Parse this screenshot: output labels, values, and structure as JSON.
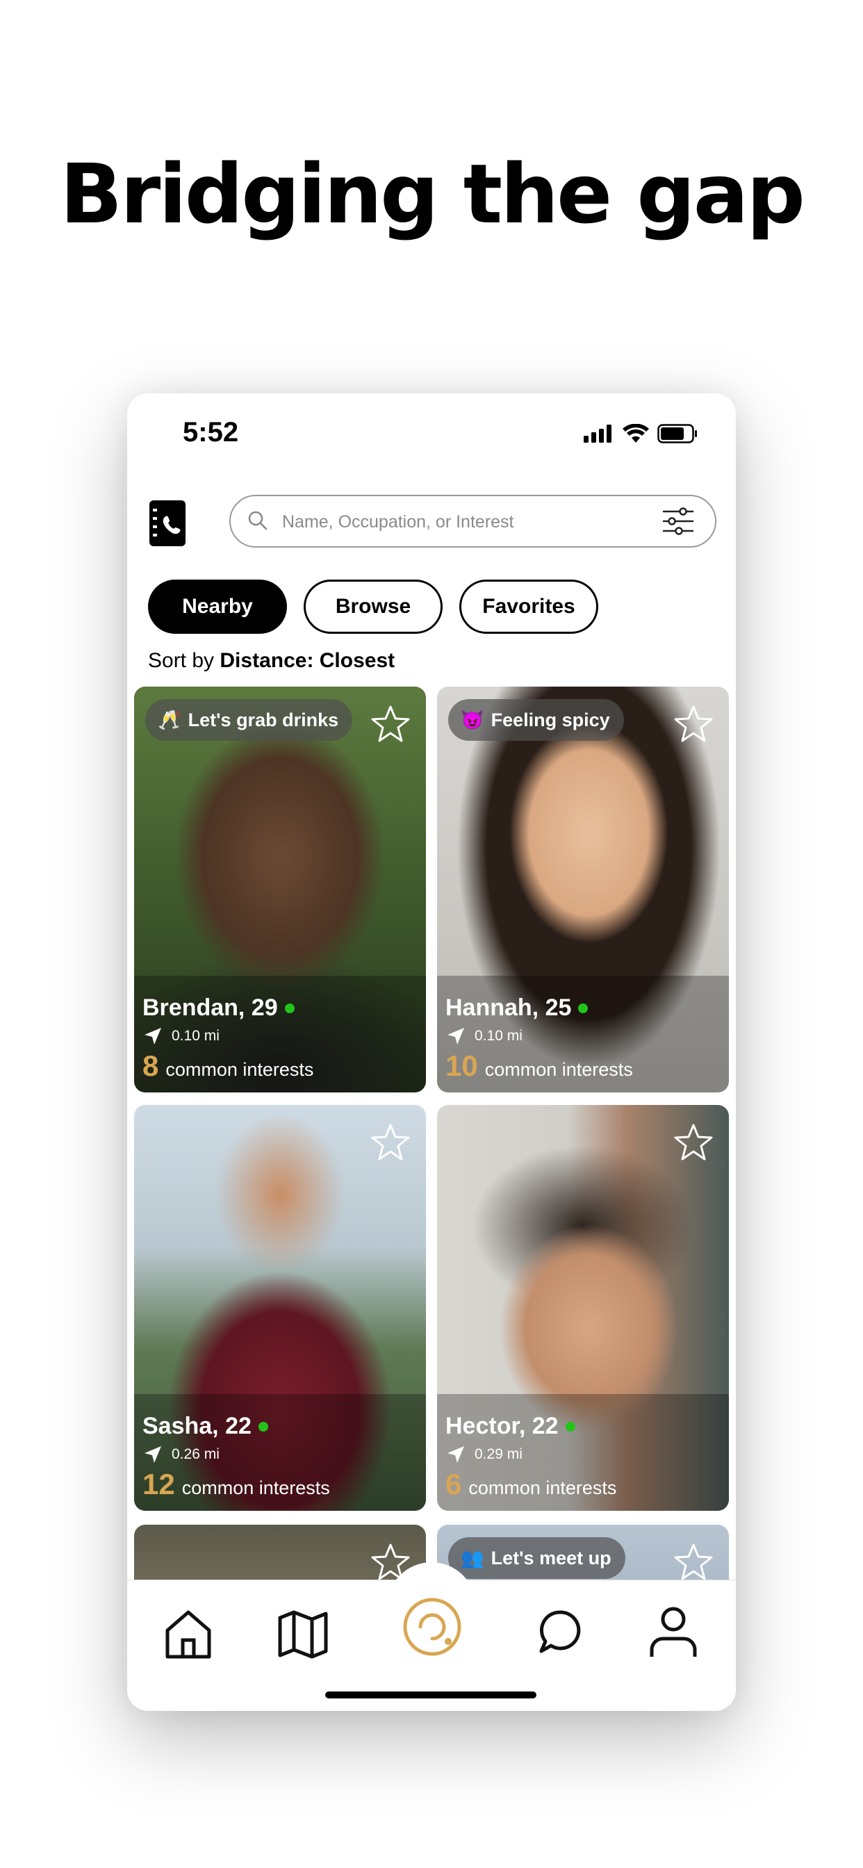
{
  "headline": "Bridging the gap",
  "status_bar": {
    "time": "5:52"
  },
  "search": {
    "placeholder": "Name, Occupation, or Interest"
  },
  "tabs": [
    {
      "label": "Nearby",
      "active": true
    },
    {
      "label": "Browse",
      "active": false
    },
    {
      "label": "Favorites",
      "active": false
    }
  ],
  "sort": {
    "prefix": "Sort by",
    "value": "Distance: Closest"
  },
  "profiles": [
    {
      "name": "Brendan, 29",
      "online": true,
      "distance": "0.10 mi",
      "common_count": "8",
      "common_label": "common interests",
      "status_emoji": "🥂",
      "status": "Let's grab drinks"
    },
    {
      "name": "Hannah, 25",
      "online": true,
      "distance": "0.10 mi",
      "common_count": "10",
      "common_label": "common interests",
      "status_emoji": "😈",
      "status": "Feeling spicy"
    },
    {
      "name": "Sasha, 22",
      "online": true,
      "distance": "0.26 mi",
      "common_count": "12",
      "common_label": "common interests"
    },
    {
      "name": "Hector, 22",
      "online": true,
      "distance": "0.29 mi",
      "common_count": "6",
      "common_label": "common interests"
    },
    {
      "status_emoji": "👥",
      "status": "Let's meet up"
    }
  ],
  "colors": {
    "accent": "#d9a652",
    "online": "#22c41a"
  },
  "nav": [
    "home-icon",
    "map-icon",
    "radar-icon",
    "chat-icon",
    "profile-icon"
  ]
}
